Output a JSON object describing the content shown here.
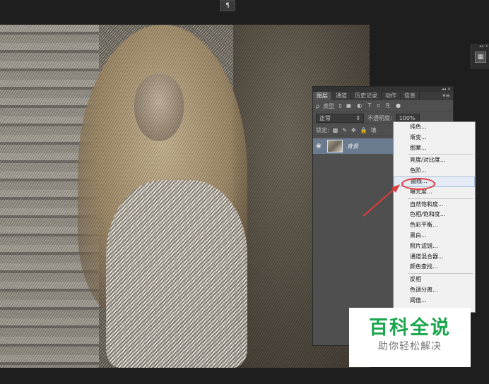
{
  "top_toolbar": {
    "paragraph_button": "¶"
  },
  "layers_panel": {
    "collapse_glyph": "◂◂ ✕",
    "tabs": [
      {
        "label": "图层",
        "active": true
      },
      {
        "label": "通道",
        "active": false
      },
      {
        "label": "历史记录",
        "active": false
      },
      {
        "label": "动作",
        "active": false
      },
      {
        "label": "信息",
        "active": false
      }
    ],
    "tab_menu_glyph": "▾≡",
    "filter": {
      "search_glyph": "ρ",
      "type_label": "类型",
      "arrows": "⇕"
    },
    "blend_mode": {
      "value": "正常",
      "arrows": "⇕"
    },
    "opacity": {
      "label": "不透明度:",
      "value": "100%"
    },
    "lock": {
      "label": "锁定:",
      "fill_label": "填"
    },
    "layers": [
      {
        "name": "背景",
        "visible": true
      }
    ]
  },
  "right_dock": {
    "header": "◂◂ ✕"
  },
  "context_menu": {
    "groups": [
      [
        "纯色...",
        "渐变...",
        "图案..."
      ],
      [
        "亮度/对比度...",
        "色阶...",
        "曲线...",
        "曝光度..."
      ],
      [
        "自然饱和度...",
        "色相/饱和度...",
        "色彩平衡...",
        "黑白...",
        "照片滤镜...",
        "通道混合器...",
        "颜色查找..."
      ],
      [
        "反相",
        "色调分离...",
        "阈值..."
      ]
    ],
    "hovered_item": "曲线..."
  },
  "annotation": {
    "circle_color": "#e23b3b",
    "arrow_color": "#e23b3b"
  },
  "watermark": {
    "title": "百科全说",
    "subtitle": "助你轻松解决",
    "title_color": "#1aa64d"
  }
}
